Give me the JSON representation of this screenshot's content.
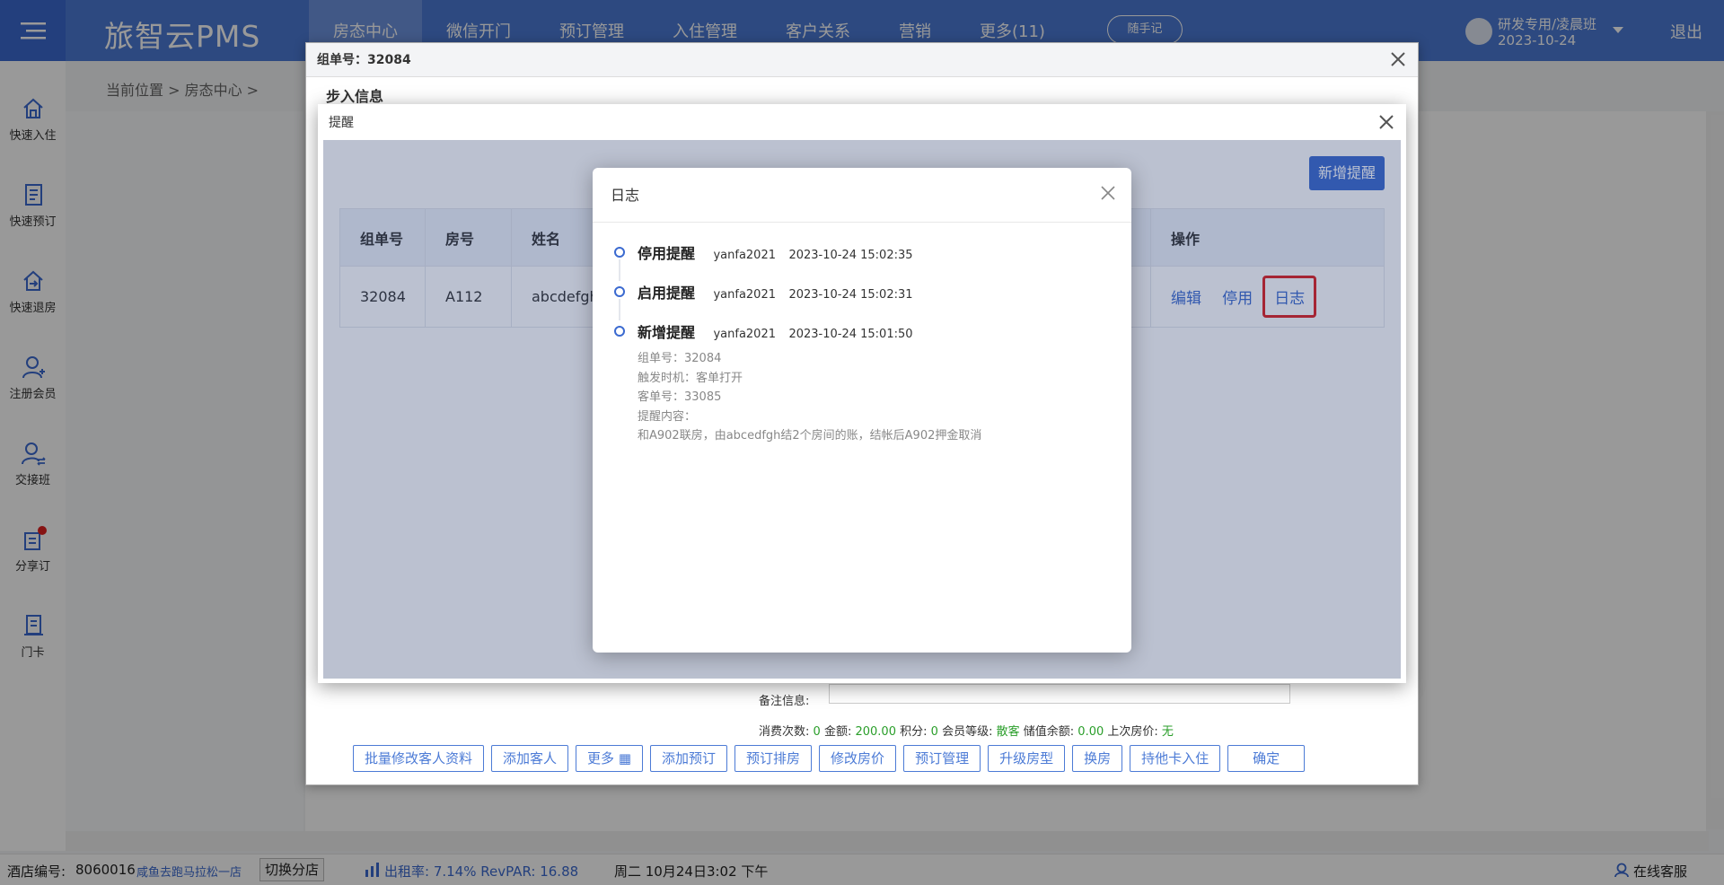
{
  "app": {
    "logo": "旅智云PMS",
    "logout": "退出",
    "notes": "随手记"
  },
  "nav": [
    "房态中心",
    "微信开门",
    "预订管理",
    "入住管理",
    "客户关系",
    "营销",
    "更多(11)"
  ],
  "user": {
    "name": "研发专用/凌晨班",
    "date": "2023-10-24"
  },
  "sidebar": [
    {
      "label": "快速入住",
      "icon": "home-icon"
    },
    {
      "label": "快速预订",
      "icon": "book-icon"
    },
    {
      "label": "快速退房",
      "icon": "checkout-icon"
    },
    {
      "label": "注册会员",
      "icon": "user-add-icon"
    },
    {
      "label": "交接班",
      "icon": "handover-icon"
    },
    {
      "label": "分享订",
      "icon": "share-icon"
    },
    {
      "label": "门卡",
      "icon": "card-icon"
    }
  ],
  "breadcrumb": "当前位置  >  房态中心  >",
  "group_dialog": {
    "title": "组单号：32084",
    "subtitle": "步入信息",
    "memo_label": "备注信息:",
    "info": {
      "visits_label": "消费次数:",
      "visits": "0",
      "amount_label": "金额:",
      "amount": "200.00",
      "points_label": "积分:",
      "points": "0",
      "level_label": "会员等级:",
      "level": "散客",
      "balance_label": "储值余额:",
      "balance": "0.00",
      "last_price_label": "上次房价:",
      "last_price": "无"
    },
    "buttons": [
      "批量修改客人资料",
      "添加客人",
      "更多",
      "添加预订",
      "预订排房",
      "修改房价",
      "预订管理",
      "升级房型",
      "换房",
      "持他卡入住",
      "确定"
    ]
  },
  "remind_dialog": {
    "title": "提醒",
    "add_button": "新增提醒",
    "columns": [
      "组单号",
      "房号",
      "姓名",
      "操作"
    ],
    "row": {
      "group_no": "32084",
      "room": "A112",
      "name": "abcdefgh"
    },
    "actions": [
      "编辑",
      "停用",
      "日志"
    ]
  },
  "log_dialog": {
    "title": "日志",
    "entries": [
      {
        "action": "停用提醒",
        "user": "yanfa2021",
        "time": "2023-10-24 15:02:35"
      },
      {
        "action": "启用提醒",
        "user": "yanfa2021",
        "time": "2023-10-24 15:02:31"
      },
      {
        "action": "新增提醒",
        "user": "yanfa2021",
        "time": "2023-10-24 15:01:50",
        "details": [
          "组单号：32084",
          "触发时机：客单打开",
          "客单号：33085",
          "提醒内容：",
          "和A902联房，由abcedfgh结2个房间的账，结帐后A902押金取消"
        ]
      }
    ]
  },
  "footer": {
    "hotel_no_label": "酒店编号:",
    "hotel_no": "8060016",
    "hotel_name": "咸鱼去跑马拉松一店",
    "switch_btn": "切换分店",
    "occupancy": "出租率:  7.14% RevPAR:  16.88",
    "datetime": "周二  10月24日3:02 下午",
    "service": "在线客服"
  },
  "colors": {
    "primary": "#4c7bd6",
    "link": "#3b6ad0",
    "highlight": "#e02020",
    "green": "#2a9e2a"
  }
}
